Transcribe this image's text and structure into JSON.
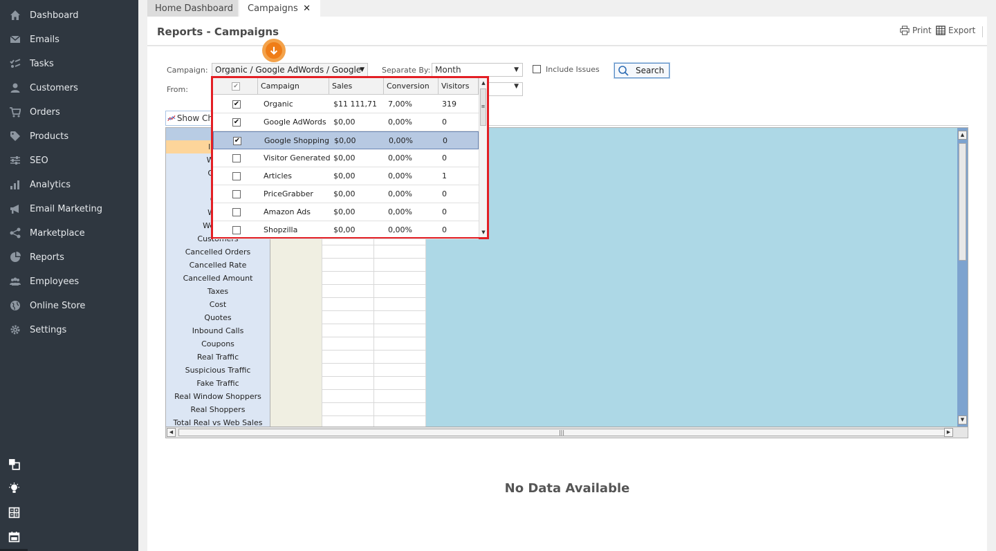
{
  "sidebar": {
    "items": [
      {
        "label": "Dashboard",
        "icon": "home-icon"
      },
      {
        "label": "Emails",
        "icon": "envelope-icon"
      },
      {
        "label": "Tasks",
        "icon": "tasks-icon"
      },
      {
        "label": "Customers",
        "icon": "user-icon"
      },
      {
        "label": "Orders",
        "icon": "cart-icon"
      },
      {
        "label": "Products",
        "icon": "tag-icon"
      },
      {
        "label": "SEO",
        "icon": "sliders-icon"
      },
      {
        "label": "Analytics",
        "icon": "bar-chart-icon"
      },
      {
        "label": "Email Marketing",
        "icon": "megaphone-icon"
      },
      {
        "label": "Marketplace",
        "icon": "share-icon"
      },
      {
        "label": "Reports",
        "icon": "pie-chart-icon"
      },
      {
        "label": "Employees",
        "icon": "users-icon"
      },
      {
        "label": "Online Store",
        "icon": "globe-icon"
      },
      {
        "label": "Settings",
        "icon": "gear-icon"
      }
    ]
  },
  "tabs": {
    "home": "Home Dashboard",
    "campaigns": "Campaigns",
    "close": "✕"
  },
  "header": {
    "title": "Reports - Campaigns",
    "print": "Print",
    "export": "Export"
  },
  "filters": {
    "campaign_label": "Campaign:",
    "campaign_value": "Organic / Google AdWords / Google",
    "separate_label": "Separate By:",
    "separate_value": "Month",
    "from_label": "From:",
    "include_issues": "Include Issues",
    "search": "Search",
    "show_chart": "Show Ch"
  },
  "dropdown": {
    "columns": [
      "Campaign",
      "Sales",
      "Conversion",
      "Visitors"
    ],
    "rows": [
      {
        "checked": "✔",
        "campaign": "Organic",
        "sales": "$11 111,71",
        "conversion": "7,00%",
        "visitors": "319"
      },
      {
        "checked": "✔",
        "campaign": "Google AdWords",
        "sales": "$0,00",
        "conversion": "0,00%",
        "visitors": "0"
      },
      {
        "checked": "✔",
        "campaign": "Google Shopping",
        "sales": "$0,00",
        "conversion": "0,00%",
        "visitors": "0"
      },
      {
        "checked": "",
        "campaign": "Visitor Generated",
        "sales": "$0,00",
        "conversion": "0,00%",
        "visitors": "0"
      },
      {
        "checked": "",
        "campaign": "Articles",
        "sales": "$0,00",
        "conversion": "0,00%",
        "visitors": "1"
      },
      {
        "checked": "",
        "campaign": "PriceGrabber",
        "sales": "$0,00",
        "conversion": "0,00%",
        "visitors": "0"
      },
      {
        "checked": "",
        "campaign": "Amazon Ads",
        "sales": "$0,00",
        "conversion": "0,00%",
        "visitors": "0"
      },
      {
        "checked": "",
        "campaign": "Shopzilla",
        "sales": "$0,00",
        "conversion": "0,00%",
        "visitors": "0"
      }
    ]
  },
  "grid": {
    "rows": [
      "Websi",
      "Offlin",
      "Av",
      "Offli",
      "Webs",
      "Website",
      "Customers",
      "Cancelled Orders",
      "Cancelled Rate",
      "Cancelled Amount",
      "Taxes",
      "Cost",
      "Quotes",
      "Inbound Calls",
      "Coupons",
      "Real Traffic",
      "Suspicious Traffic",
      "Fake Traffic",
      "Real Window Shoppers",
      "Real Shoppers",
      "Total Real vs Web Sales"
    ],
    "header_fragment": "I"
  },
  "empty_state": "No Data Available",
  "colors": {
    "sidebar": "#2f3740",
    "highlight": "#e31e24",
    "accent": "#ef7d17",
    "grid_blue": "#add8e6"
  }
}
